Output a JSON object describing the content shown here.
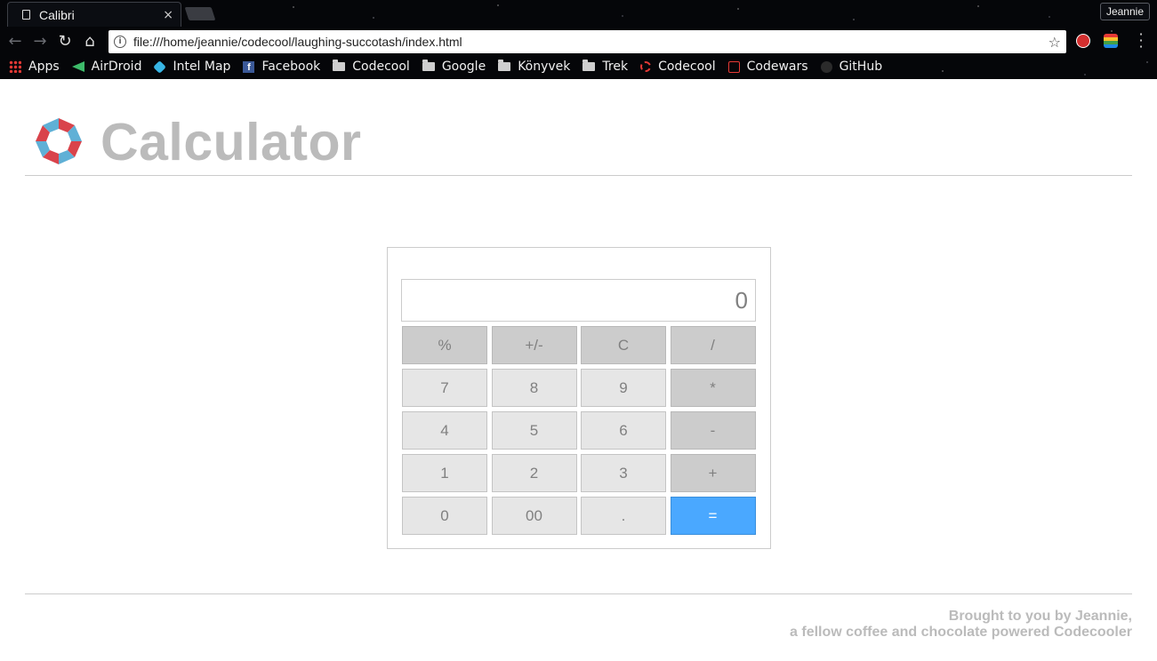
{
  "browser": {
    "tab_title": "Calibri",
    "tab_close": "×",
    "user_name": "Jeannie",
    "url": "file:///home/jeannie/codecool/laughing-succotash/index.html",
    "bookmarks": [
      {
        "label": "Apps",
        "icon": "apps-icon"
      },
      {
        "label": "AirDroid",
        "icon": "airdroid-icon"
      },
      {
        "label": "Intel Map",
        "icon": "intel-map-icon"
      },
      {
        "label": "Facebook",
        "icon": "facebook-icon"
      },
      {
        "label": "Codecool",
        "icon": "folder-icon"
      },
      {
        "label": "Google",
        "icon": "folder-icon"
      },
      {
        "label": "Könyvek",
        "icon": "folder-icon"
      },
      {
        "label": "Trek",
        "icon": "folder-icon"
      },
      {
        "label": "Codecool",
        "icon": "codecool-icon"
      },
      {
        "label": "Codewars",
        "icon": "codewars-icon"
      },
      {
        "label": "GitHub",
        "icon": "github-icon"
      }
    ]
  },
  "header": {
    "title": "Calculator"
  },
  "calculator": {
    "display": "0",
    "keys": [
      [
        "%",
        "+/-",
        "C",
        "/"
      ],
      [
        "7",
        "8",
        "9",
        "*"
      ],
      [
        "4",
        "5",
        "6",
        "-"
      ],
      [
        "1",
        "2",
        "3",
        "+"
      ],
      [
        "0",
        "00",
        ".",
        "="
      ]
    ]
  },
  "footer": {
    "line1": "Brought to you by Jeannie,",
    "line2": "a fellow coffee and chocolate powered Codecooler"
  },
  "colors": {
    "accent": "#4aa8ff",
    "title_gray": "#bbbbbb",
    "key_light": "#e6e6e6",
    "key_operator": "#cccccc"
  }
}
